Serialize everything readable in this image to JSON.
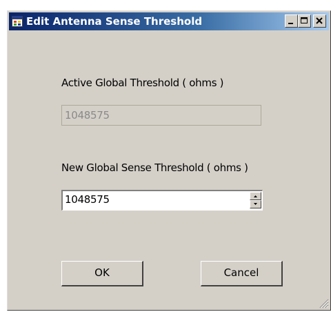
{
  "window": {
    "title": "Edit Antenna Sense Threshold",
    "icons": {
      "app": "app-window-icon",
      "minimize": "minimize-icon",
      "maximize": "maximize-icon",
      "close": "close-icon",
      "resize": "resize-grip-icon"
    }
  },
  "active_threshold": {
    "label": "Active Global Threshold ( ohms )",
    "value": "1048575",
    "disabled": true
  },
  "new_threshold": {
    "label": "New Global Sense Threshold ( ohms )",
    "value": "1048575"
  },
  "buttons": {
    "ok_label": "OK",
    "cancel_label": "Cancel"
  },
  "colors": {
    "dialog_background": "#d4d0c8",
    "titlebar_start": "#0a246a",
    "titlebar_end": "#a6caf0"
  }
}
